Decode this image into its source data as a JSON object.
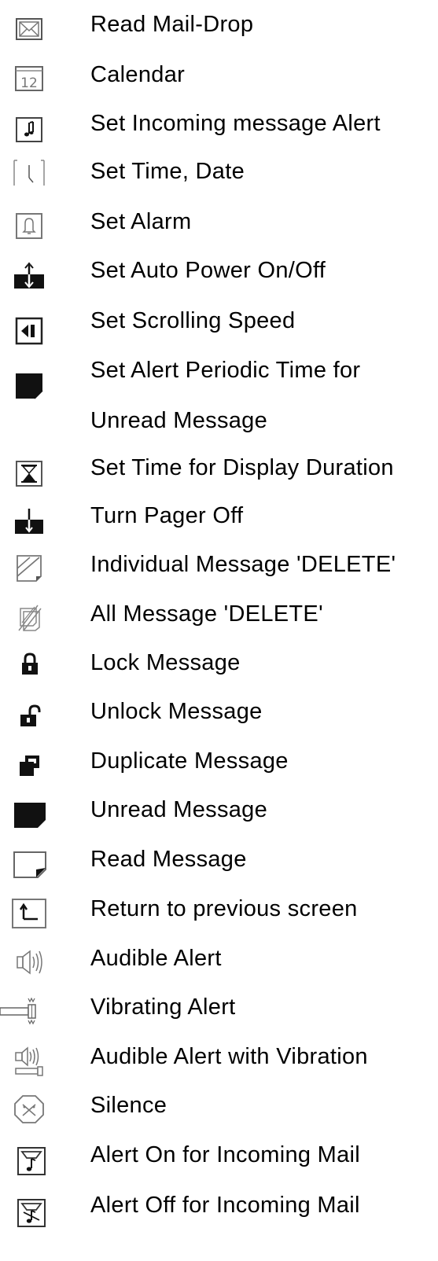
{
  "legend": {
    "items": [
      {
        "icon": "mail-envelope-icon",
        "label": "Read Mail-Drop"
      },
      {
        "icon": "calendar-icon",
        "label": "Calendar",
        "icon_text": "12"
      },
      {
        "icon": "music-note-icon",
        "label": "Set Incoming message Alert"
      },
      {
        "icon": "clock-icon",
        "label": "Set Time, Date"
      },
      {
        "icon": "bell-icon",
        "label": "Set Alarm"
      },
      {
        "icon": "auto-power-icon",
        "label": "Set Auto Power On/Off"
      },
      {
        "icon": "scroll-speed-icon",
        "label": "Set Scrolling Speed"
      },
      {
        "icon": "unread-periodic-icon",
        "label": "Set Alert Periodic Time for",
        "label_2": "Unread Message"
      },
      {
        "icon": "hourglass-icon",
        "label": "Set Time for Display Duration"
      },
      {
        "icon": "power-off-icon",
        "label": "Turn Pager Off"
      },
      {
        "icon": "delete-single-icon",
        "label": "Individual Message 'DELETE'"
      },
      {
        "icon": "delete-all-icon",
        "label": "All Message 'DELETE'"
      },
      {
        "icon": "lock-icon",
        "label": "Lock Message"
      },
      {
        "icon": "unlock-icon",
        "label": "Unlock Message"
      },
      {
        "icon": "duplicate-icon",
        "label": "Duplicate Message"
      },
      {
        "icon": "unread-message-icon",
        "label": "Unread Message"
      },
      {
        "icon": "read-message-icon",
        "label": "Read Message"
      },
      {
        "icon": "return-icon",
        "label": "Return to previous screen"
      },
      {
        "icon": "speaker-icon",
        "label": "Audible Alert"
      },
      {
        "icon": "vibrate-icon",
        "label": "Vibrating Alert"
      },
      {
        "icon": "speaker-vibrate-icon",
        "label": "Audible Alert with Vibration"
      },
      {
        "icon": "silence-icon",
        "label": "Silence"
      },
      {
        "icon": "mail-alert-on-icon",
        "label": "Alert On for Incoming Mail"
      },
      {
        "icon": "mail-alert-off-icon",
        "label": "Alert Off for Incoming Mail"
      }
    ]
  }
}
